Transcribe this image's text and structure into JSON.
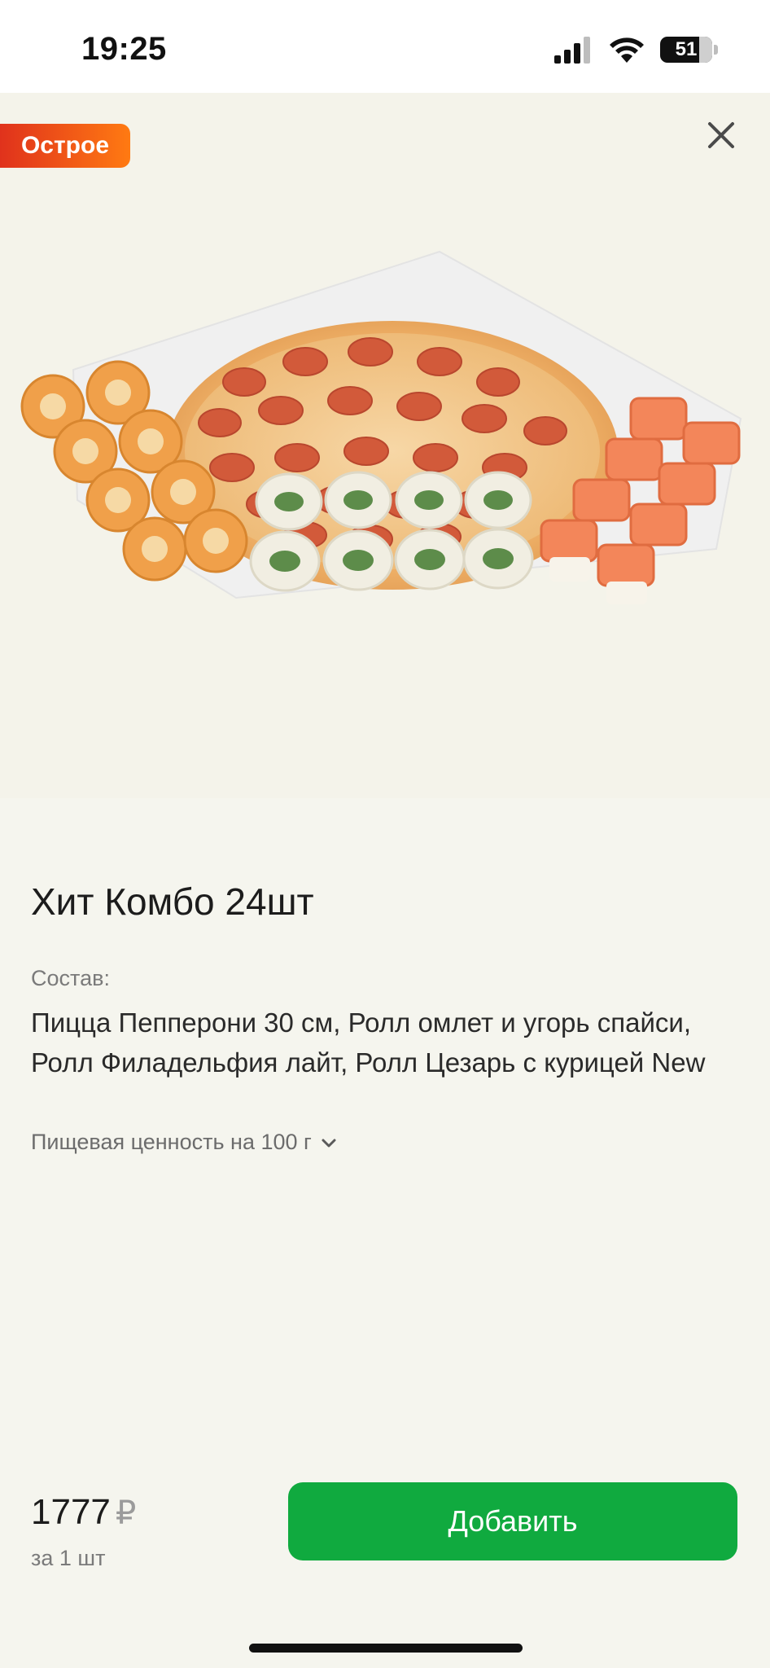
{
  "status_bar": {
    "time": "19:25",
    "battery_level": "51",
    "icons": [
      "signal-icon",
      "wifi-icon",
      "battery-icon"
    ]
  },
  "hero": {
    "badge_label": "Острое",
    "badge_colors": [
      "#e0321c",
      "#ff7a12"
    ],
    "close_icon": "close-icon",
    "image": "pizza-and-sushi-rolls-combo"
  },
  "product": {
    "title": "Хит Комбо 24шт",
    "composition_label": "Состав:",
    "composition_text": "Пицца Пепперони 30 см, Ролл омлет и угорь спайси, Ролл Филадельфия лайт, Ролл Цезарь с курицей New",
    "nutrition_label": "Пищевая ценность на 100 г",
    "nutrition_icon": "chevron-down-icon"
  },
  "purchase": {
    "price": "1777",
    "currency": "₽",
    "per_unit": "за 1 шт",
    "add_button_label": "Добавить",
    "accent_color": "#10aa3f"
  }
}
